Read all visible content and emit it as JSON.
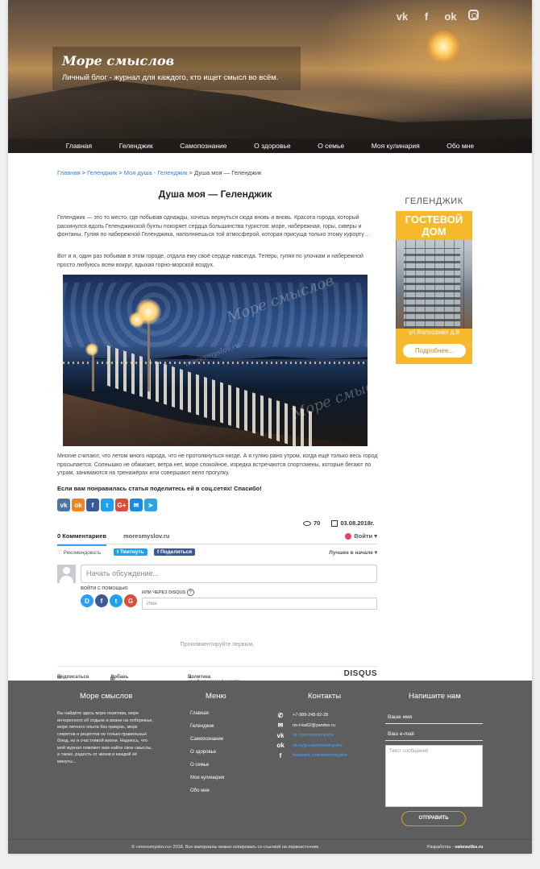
{
  "header": {
    "site_title": "Море смыслов",
    "tagline": "Личный блог - журнал для каждого, кто ищет смысл во всём.",
    "social": [
      "vk-icon",
      "facebook-icon",
      "odnoklassniki-icon",
      "instagram-icon"
    ],
    "nav": [
      "Главная",
      "Геленджик",
      "Самопознание",
      "О здоровье",
      "О семье",
      "Моя кулинария",
      "Обо мне"
    ]
  },
  "breadcrumb": {
    "items": [
      "Главная",
      "Геленджик",
      "Моя душа - Геленджик"
    ],
    "current": "Душа моя — Геленджик",
    "sep": " > "
  },
  "post": {
    "title": "Душа моя — Геленджик",
    "p1": "Геленджик — это то место, где побывав однажды, хочешь вернуться сюда вновь и вновь. Красота города, который раскинулся вдоль Геленджикской бухты покоряет сердца большинства туристов: море, набережная, горы, скверы и фонтаны. Гуляя по набережной Геленджика, наполняешься той атмосферой, которая присуща только этому курорту…",
    "p2": "Вот и я, один раз побывав в этом городе, отдала ему своё сердце навсегда. Теперь, гуляя по улочкам и набережной просто любуюсь всем вокруг, вдыхая горно-морской воздух.",
    "watermark": "Море смыслов",
    "watermark_url": "moresmyslov.ru",
    "p3": "Многие считают, что летом много народа, что не протолкнуться нигде. А я гуляю рано утром, когда ещё только весь город просыпается. Солнышко не обжигает, ветра нет, море спокойное, изредка встречаются спортсмены, которые бегают по утрам, занимаются на тренажёрах или совершают вело прогулку.",
    "share_title": "Если вам понравилась статья поделитесь ей в соц.сетях! Спасибо!",
    "share_buttons": [
      {
        "icon": "vk-icon",
        "glyph": "vk",
        "color": "#4c75a3"
      },
      {
        "icon": "odnoklassniki-icon",
        "glyph": "ok",
        "color": "#f58220"
      },
      {
        "icon": "facebook-icon",
        "glyph": "f",
        "color": "#3b5998"
      },
      {
        "icon": "twitter-icon",
        "glyph": "t",
        "color": "#1da1f2"
      },
      {
        "icon": "googleplus-icon",
        "glyph": "G+",
        "color": "#dd4b39"
      },
      {
        "icon": "mail-icon",
        "glyph": "✉",
        "color": "#168de2"
      },
      {
        "icon": "telegram-icon",
        "glyph": "➤",
        "color": "#2ca5e0"
      }
    ],
    "views": "70",
    "date": "03.08.2018г."
  },
  "disqus": {
    "tab_comments": "0 Комментариев",
    "tab_site": "moresmyslov.ru",
    "login": "Войти",
    "recommend": "Рекомендовать",
    "tweet": "Твитнуть",
    "share_fb": "Поделиться",
    "sort": "Лучшее в начале",
    "placeholder": "Начать обсуждение...",
    "login_with": "ВОЙТИ С ПОМОЩЬЮ",
    "providers": [
      {
        "icon": "disqus-icon",
        "glyph": "D",
        "color": "#2e9fff"
      },
      {
        "icon": "facebook-icon",
        "glyph": "f",
        "color": "#3b5998"
      },
      {
        "icon": "twitter-icon",
        "glyph": "t",
        "color": "#1da1f2"
      },
      {
        "icon": "google-icon",
        "glyph": "G",
        "color": "#dd4b39"
      }
    ],
    "or_via": "ИЛИ ЧЕРЕЗ DISQUS",
    "name_placeholder": "Имя",
    "empty": "Прокомментируйте первым.",
    "subscribe": "Подписаться",
    "add_disqus": "Добавь Disqus на свой сайт",
    "privacy": "Политика конфиденциальности Disqus",
    "logo": "DISQUS"
  },
  "sidebar": {
    "title": "ГЕЛЕНДЖИК",
    "ad_head_1": "ГОСТЕВОЙ",
    "ad_head_2": "ДОМ",
    "ad_address": "ул.Колхозная д.8",
    "ad_button": "Подробнее..."
  },
  "footer": {
    "about_title": "Море смыслов",
    "about_text": "Вы найдёте здесь море позитива, море интересного об отдыхе и жизни на побережье, море личного опыта без прикрас, море секретов и рецептов не только правильных блюд, но и счастливой жизни. Надеюсь, что мой журнал поможет вам найти свои смыслы, а также, радость от жизни и каждой её минуты...",
    "menu_title": "Меню",
    "menu": [
      "Главная",
      "Геленджик",
      "Самопознание",
      "О здоровье",
      "О семье",
      "Моя кулинария",
      "Обо мне"
    ],
    "contacts_title": "Контакты",
    "contacts": [
      {
        "icon": "phone-icon",
        "glyph": "✆",
        "text": "+7-989-248-92-28",
        "link": false
      },
      {
        "icon": "mail-icon",
        "glyph": "✉",
        "text": "no-t-ka62@yandex.ru",
        "link": false
      },
      {
        "icon": "vk-icon",
        "glyph": "vk",
        "text": "vk.com/moresmyslov",
        "link": true
      },
      {
        "icon": "odnoklassniki-icon",
        "glyph": "ok",
        "text": "ok.ru/group/moresmyslov",
        "link": true
      },
      {
        "icon": "facebook-icon",
        "glyph": "f",
        "text": "facebook.com/moresmyslov",
        "link": true
      }
    ],
    "write_title": "Напишите нам",
    "name_ph": "Ваше имя",
    "email_ph": "Ваш e-mail",
    "msg_ph": "Текст сообщения",
    "send": "ОТПРАВИТЬ",
    "copyright": "© «moresmyslov.ru» 2018. Все материалы можно копировать со ссылкой на первоисточник.",
    "dev_label": "Разработка - ",
    "dev_name": "valeravilks.ru"
  }
}
